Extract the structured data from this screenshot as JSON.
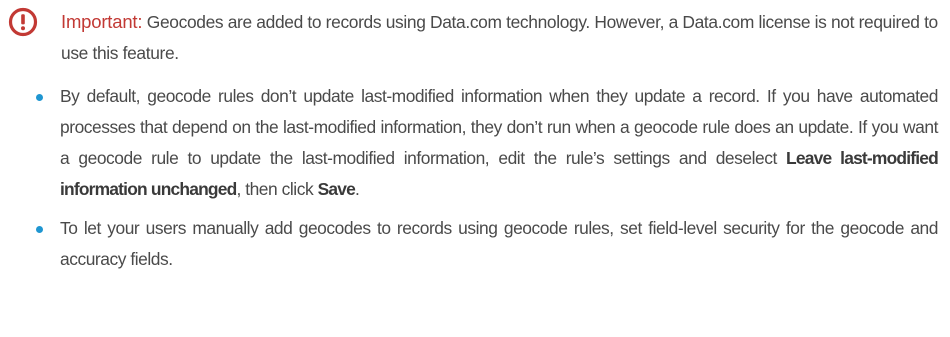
{
  "important_note": {
    "label": "Important:",
    "text": " Geocodes are added to records using Data.com technology. However, a Data.com license is not required to use this feature.",
    "icon": "alert-circle-icon",
    "accent_color": "#c23934"
  },
  "bullets": [
    {
      "text_before": "By default, geocode rules don’t update last-modified information when they update a record. If you have automated processes that depend on the last-modified information, they don’t run when a geocode rule does an update. If you want a geocode rule to update the last-modified information, edit the rule’s settings and deselect ",
      "ui_term_1": "Leave last-modified information unchanged",
      "text_middle": ", then click ",
      "ui_term_2": "Save",
      "text_after": "."
    },
    {
      "text": "To let your users manually add geocodes to records using geocode rules, set field-level security for the geocode and accuracy fields."
    }
  ],
  "bullet_color": "#1f96d1"
}
